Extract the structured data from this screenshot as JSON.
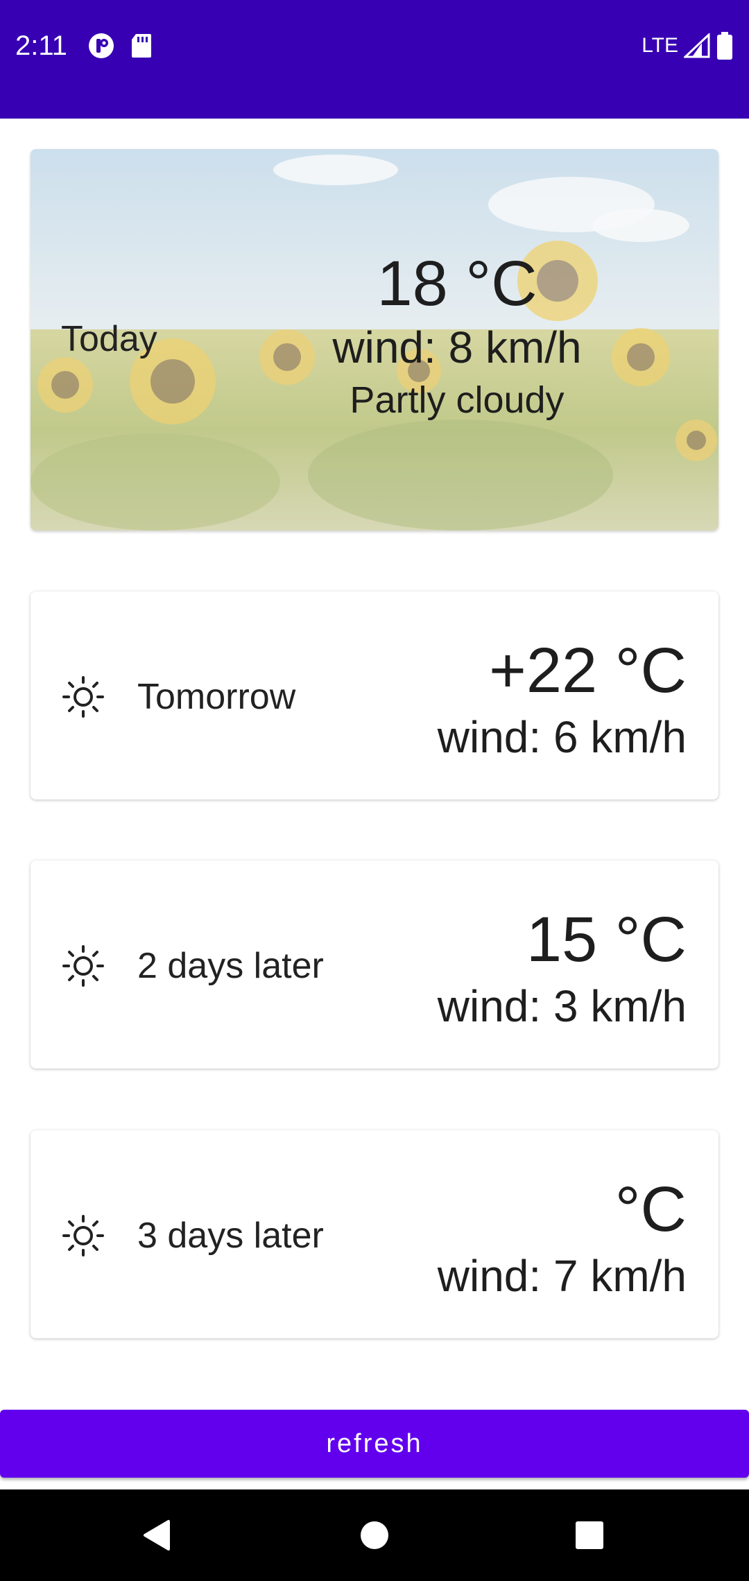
{
  "status_bar": {
    "time": "2:11",
    "network": "LTE",
    "icons": [
      "privacy-indicator-icon",
      "sd-card-icon",
      "signal-icon",
      "battery-icon"
    ],
    "background_color": "#3700b3"
  },
  "today": {
    "label": "Today",
    "temperature": "18 °C",
    "wind": "wind: 8 km/h",
    "condition": "Partly cloudy",
    "background_image": "sunflower-field"
  },
  "forecast": [
    {
      "icon": "sun-icon",
      "day": "Tomorrow",
      "temperature": "+22 °C",
      "wind": "wind: 6 km/h"
    },
    {
      "icon": "sun-icon",
      "day": "2 days later",
      "temperature": "15 °C",
      "wind": "wind: 3 km/h"
    },
    {
      "icon": "sun-icon",
      "day": "3 days later",
      "temperature": "°C",
      "wind": "wind: 7 km/h"
    }
  ],
  "refresh_button": {
    "label": "refresh",
    "color": "#6200ee"
  },
  "nav_bar": {
    "buttons": [
      "back-icon",
      "home-icon",
      "recents-icon"
    ]
  }
}
